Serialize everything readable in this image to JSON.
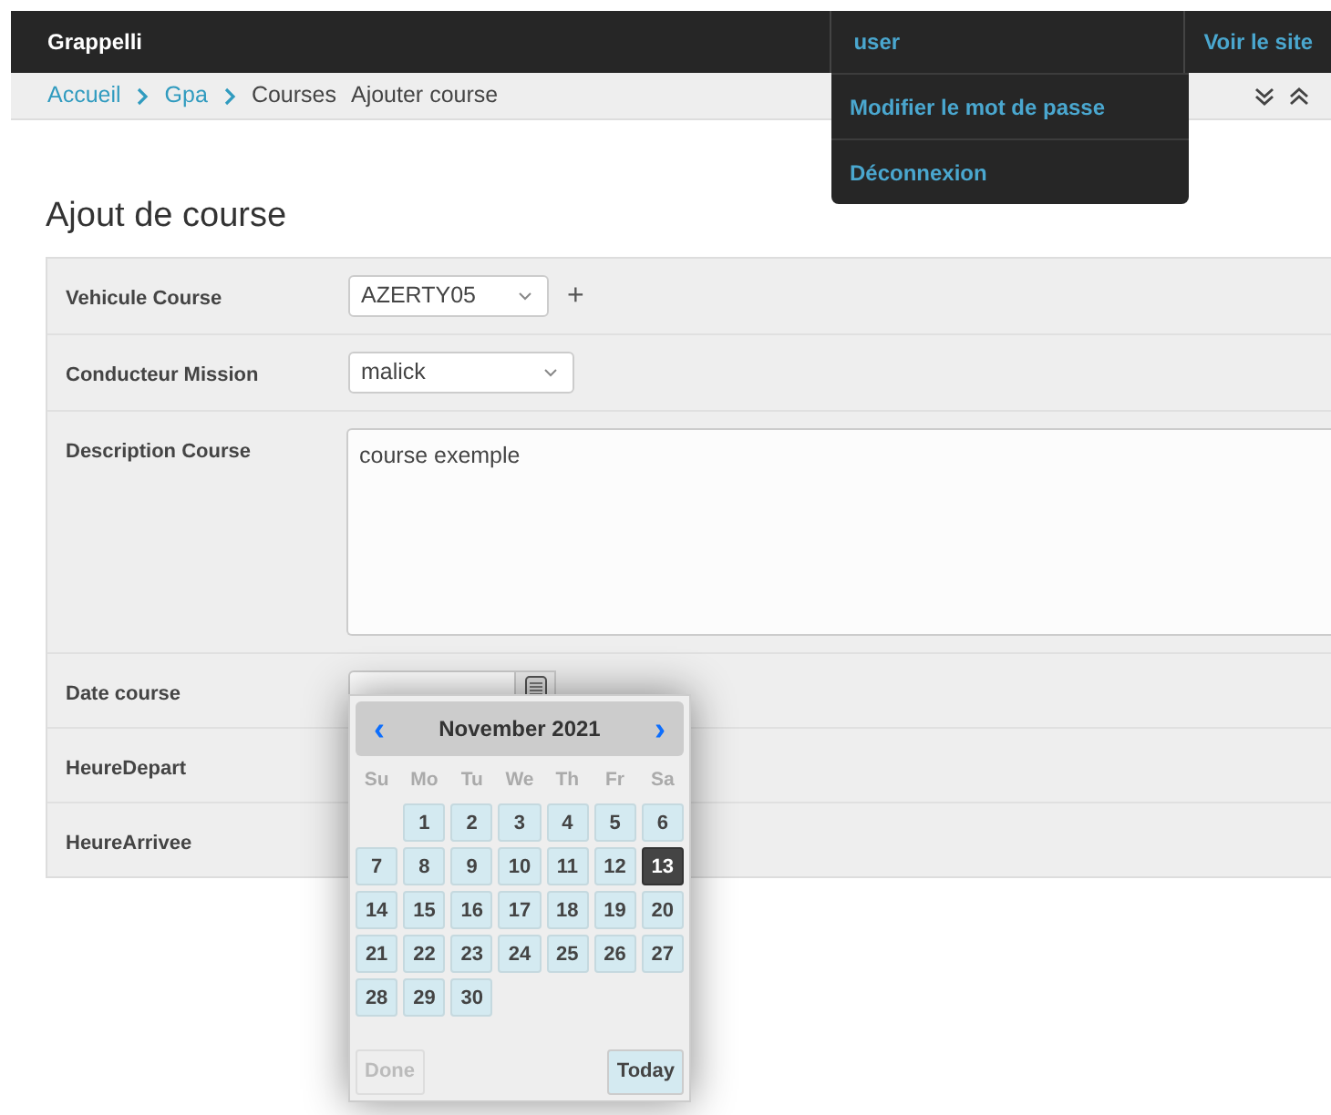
{
  "header": {
    "brand": "Grappelli",
    "user_menu": {
      "label": "user",
      "expanded": true,
      "items": [
        "Modifier le mot de passe",
        "Déconnexion"
      ]
    },
    "site_link": "Voir le site"
  },
  "breadcrumbs": [
    {
      "label": "Accueil",
      "link": true
    },
    {
      "label": "Gpa",
      "link": true
    },
    {
      "label": "Courses",
      "link": false
    },
    {
      "label": "Ajouter course",
      "link": false
    }
  ],
  "heading": "Ajout de course",
  "fields": [
    {
      "kind": "select",
      "label": "Vehicule Course",
      "value": "AZERTY05",
      "add": "+"
    },
    {
      "kind": "select",
      "label": "Conducteur Mission",
      "value": "malick"
    },
    {
      "kind": "textarea",
      "label": "Description Course",
      "value": "course exemple"
    },
    {
      "kind": "date",
      "label": "Date course"
    },
    {
      "kind": "time",
      "label": "HeureDepart"
    },
    {
      "kind": "time",
      "label": "HeureArrivee"
    }
  ],
  "datepicker": {
    "prev": "‹",
    "title": "November 2021",
    "next": "›",
    "weekdays": [
      "Su",
      "Mo",
      "Tu",
      "We",
      "Th",
      "Fr",
      "Sa"
    ],
    "weeks": [
      [
        {
          "kind": "empty"
        },
        {
          "day": "1",
          "selected": false
        },
        {
          "day": "2",
          "selected": false
        },
        {
          "day": "3",
          "selected": false
        },
        {
          "day": "4",
          "selected": false
        },
        {
          "day": "5",
          "selected": false
        },
        {
          "day": "6",
          "selected": false
        }
      ],
      [
        {
          "day": "7",
          "selected": false
        },
        {
          "day": "8",
          "selected": false
        },
        {
          "day": "9",
          "selected": false
        },
        {
          "day": "10",
          "selected": false
        },
        {
          "day": "11",
          "selected": false
        },
        {
          "day": "12",
          "selected": false
        },
        {
          "day": "13",
          "selected": true
        }
      ],
      [
        {
          "day": "14",
          "selected": false
        },
        {
          "day": "15",
          "selected": false
        },
        {
          "day": "16",
          "selected": false
        },
        {
          "day": "17",
          "selected": false
        },
        {
          "day": "18",
          "selected": false
        },
        {
          "day": "19",
          "selected": false
        },
        {
          "day": "20",
          "selected": false
        }
      ],
      [
        {
          "day": "21",
          "selected": false
        },
        {
          "day": "22",
          "selected": false
        },
        {
          "day": "23",
          "selected": false
        },
        {
          "day": "24",
          "selected": false
        },
        {
          "day": "25",
          "selected": false
        },
        {
          "day": "26",
          "selected": false
        },
        {
          "day": "27",
          "selected": false
        }
      ],
      [
        {
          "day": "28",
          "selected": false
        },
        {
          "day": "29",
          "selected": false
        },
        {
          "day": "30",
          "selected": false
        }
      ]
    ],
    "buttons": [
      {
        "label": "Done",
        "disabled": true
      },
      {
        "label": "Today",
        "disabled": false
      }
    ]
  }
}
